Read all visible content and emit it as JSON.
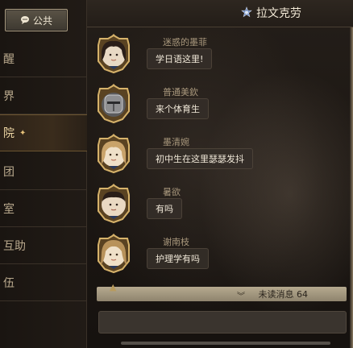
{
  "sidebar": {
    "public_label": "公共",
    "items": [
      {
        "label": "醒",
        "active": false
      },
      {
        "label": "界",
        "active": false
      },
      {
        "label": "院",
        "active": true
      },
      {
        "label": "团",
        "active": false
      },
      {
        "label": "室",
        "active": false
      },
      {
        "label": "互助",
        "active": false
      },
      {
        "label": "伍",
        "active": false
      }
    ]
  },
  "header": {
    "title": "拉文克劳",
    "emblem_icon": "ravenclaw-crest-icon"
  },
  "messages": [
    {
      "name": "迷惑的墨菲",
      "text": "学日语这里!",
      "avatar": "avatar-dark-hair-girl"
    },
    {
      "name": "普通美欽",
      "text": "来个体育生",
      "avatar": "avatar-knight-helmet"
    },
    {
      "name": "墨清婉",
      "text": "初中生在这里瑟瑟发抖",
      "avatar": "avatar-blonde-girl"
    },
    {
      "name": "暑欲",
      "text": "有吗",
      "avatar": "avatar-dark-hair-boy"
    },
    {
      "name": "谢南枝",
      "text": "护理学有吗",
      "avatar": "avatar-blonde-long-hair"
    }
  ],
  "unread": {
    "label": "未读消息 64"
  },
  "input": {
    "value": "",
    "placeholder": ""
  },
  "colors": {
    "accent_gold": "#c9a45c",
    "bubble_bg": "#342e28",
    "unread_bar": "#a59a82"
  }
}
